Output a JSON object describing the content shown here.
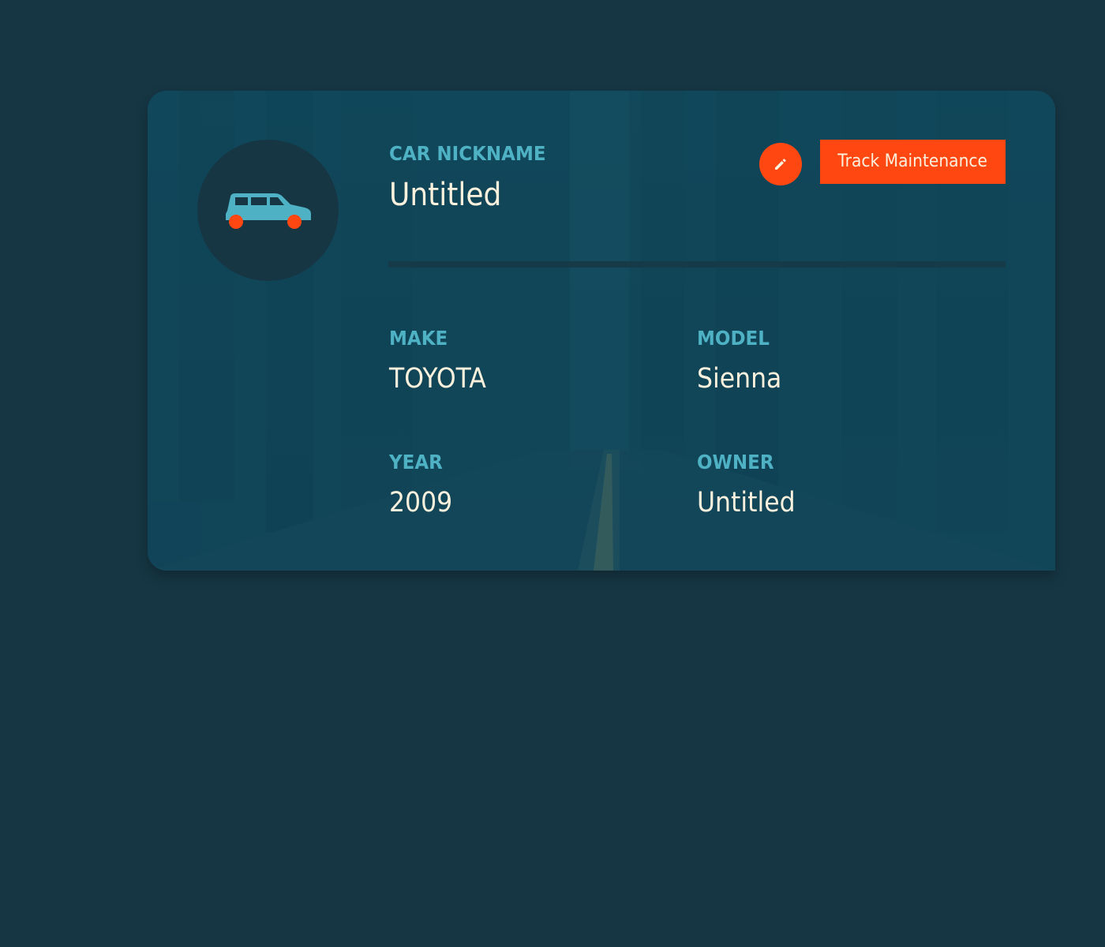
{
  "vehicle_card": {
    "nickname_label": "CAR NICKNAME",
    "nickname_value": "Untitled",
    "track_maintenance_label": "Track Maintenance",
    "make_label": "MAKE",
    "make_value": "TOYOTA",
    "model_label": "MODEL",
    "model_value": "Sienna",
    "year_label": "YEAR",
    "year_value": "2009",
    "owner_label": "OWNER",
    "owner_value": "Untitled"
  },
  "icons": {
    "avatar": "car-icon",
    "edit": "pencil-icon"
  },
  "colors": {
    "page_background": "#163644",
    "card_background": "#124a5d",
    "accent": "#ff4712",
    "label": "#4eb2c4",
    "value_text": "#fbf1dd"
  }
}
